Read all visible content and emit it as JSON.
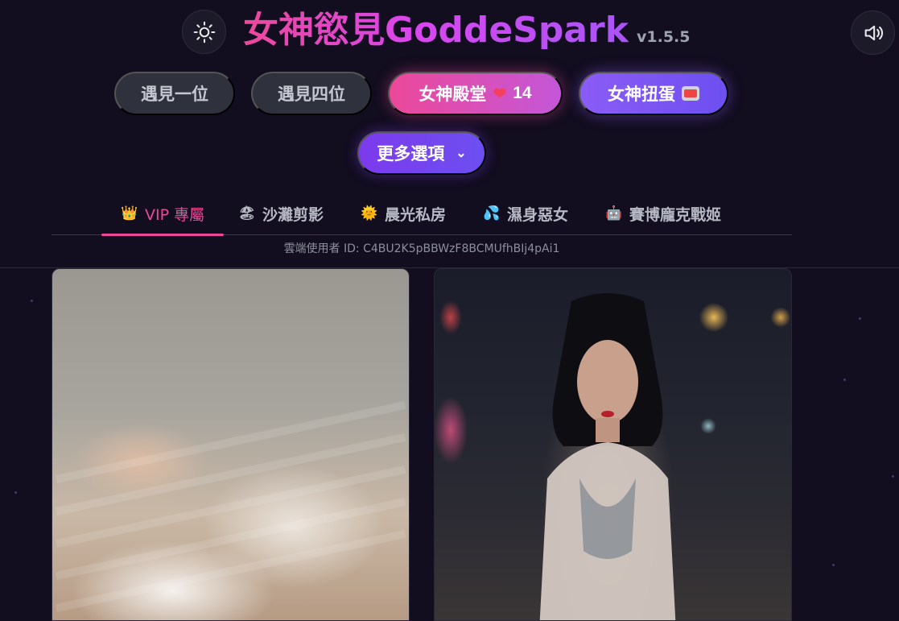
{
  "app": {
    "title": "女神慾見GoddeSpark",
    "version": "v1.5.5"
  },
  "header": {
    "theme_toggle": "sun-icon",
    "sound_toggle": "speaker-icon"
  },
  "actions": {
    "meet_one": "遇見一位",
    "meet_four": "遇見四位",
    "hall_label": "女神殿堂",
    "hall_icon": "heart-icon",
    "hall_count": "14",
    "gacha_label": "女神扭蛋",
    "gacha_icon": "slot-machine-icon",
    "more_label": "更多選項",
    "more_icon": "chevron-down-icon"
  },
  "tabs": [
    {
      "label": "VIP 專屬",
      "icon": "crown-icon",
      "glyph": "👑",
      "active": true
    },
    {
      "label": "沙灘剪影",
      "icon": "beach-umbrella-icon",
      "glyph": "🏖",
      "active": false
    },
    {
      "label": "晨光私房",
      "icon": "sun-glow-icon",
      "glyph": "🌞",
      "active": false
    },
    {
      "label": "濕身惡女",
      "icon": "water-drops-icon",
      "glyph": "💦",
      "active": false
    },
    {
      "label": "賽博龐克戰姬",
      "icon": "robot-icon",
      "glyph": "🤖",
      "active": false
    }
  ],
  "user": {
    "id_text": "雲端使用者 ID: C4BU2K5pBBWzF8BCMUfhBIj4pAi1"
  },
  "gallery": [
    {
      "name": "photo-card-1"
    },
    {
      "name": "photo-card-2"
    }
  ],
  "colors": {
    "background": "#120d1f",
    "accent_pink": "#ec4899",
    "accent_purple": "#8b5cf6",
    "button_gray": "#2f323c"
  }
}
